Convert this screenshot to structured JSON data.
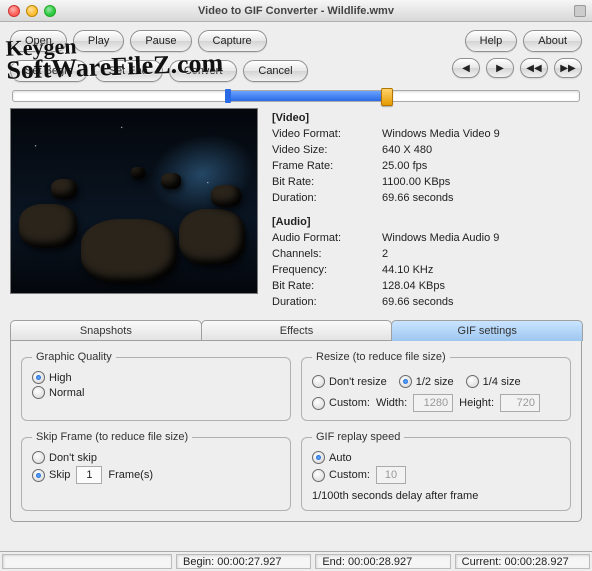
{
  "window": {
    "title": "Video to GIF Converter - Wildlife.wmv"
  },
  "toolbar": {
    "open": "Open",
    "play": "Play",
    "pause": "Pause",
    "capture": "Capture",
    "setbegin": "Set Begin",
    "setend": "Set End",
    "convert": "Convert",
    "cancel": "Cancel",
    "help": "Help",
    "about": "About"
  },
  "nav": {
    "prev": "◀",
    "next": "▶",
    "first": "◀◀",
    "last": "▶▶"
  },
  "slider": {
    "start_pct": 38,
    "end_pct": 66,
    "thumb_pct": 66
  },
  "video": {
    "section": "[Video]",
    "format_k": "Video Format:",
    "format_v": "Windows Media Video 9",
    "size_k": "Video Size:",
    "size_v": "640 X 480",
    "fps_k": "Frame Rate:",
    "fps_v": "25.00 fps",
    "bitrate_k": "Bit Rate:",
    "bitrate_v": "1100.00 KBps",
    "dur_k": "Duration:",
    "dur_v": "69.66 seconds"
  },
  "audio": {
    "section": "[Audio]",
    "format_k": "Audio Format:",
    "format_v": "Windows Media Audio 9",
    "ch_k": "Channels:",
    "ch_v": "2",
    "freq_k": "Frequency:",
    "freq_v": "44.10 KHz",
    "bitrate_k": "Bit Rate:",
    "bitrate_v": "128.04 KBps",
    "dur_k": "Duration:",
    "dur_v": "69.66 seconds"
  },
  "tabs": {
    "snapshots": "Snapshots",
    "effects": "Effects",
    "gif": "GIF settings"
  },
  "quality": {
    "legend": "Graphic Quality",
    "high": "High",
    "normal": "Normal",
    "value": "high"
  },
  "resize": {
    "legend": "Resize (to reduce file size)",
    "none": "Don't resize",
    "half": "1/2 size",
    "quarter": "1/4 size",
    "custom": "Custom:",
    "width_l": "Width:",
    "width_v": "1280",
    "height_l": "Height:",
    "height_v": "720",
    "value": "half"
  },
  "skip": {
    "legend": "Skip Frame (to reduce file size)",
    "none": "Don't skip",
    "skip": "Skip",
    "frames": "Frame(s)",
    "value": "skip",
    "n": "1"
  },
  "replay": {
    "legend": "GIF replay speed",
    "auto": "Auto",
    "custom": "Custom:",
    "suffix": "1/100th seconds delay after frame",
    "value": "auto",
    "n": "10"
  },
  "status": {
    "begin_l": "Begin:",
    "begin_v": "00:00:27.927",
    "end_l": "End:",
    "end_v": "00:00:28.927",
    "cur_l": "Current:",
    "cur_v": "00:00:28.927"
  },
  "watermark": {
    "l1": "Keygen",
    "l2": "SoftWareFileZ.com"
  }
}
